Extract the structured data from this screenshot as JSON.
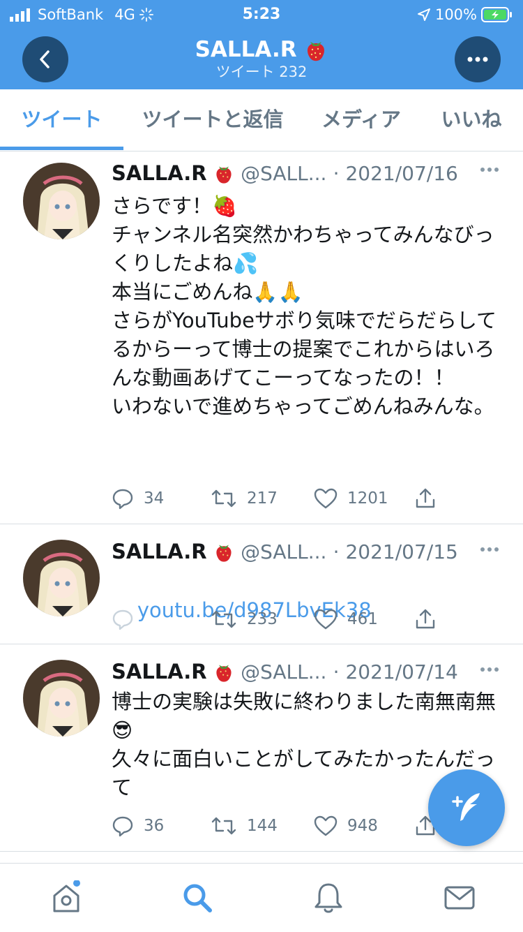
{
  "status_bar": {
    "carrier": "SoftBank",
    "network": "4G",
    "time": "5:23",
    "battery": "100%"
  },
  "header": {
    "title": "SALLA.R",
    "subtitle": "ツイート 232",
    "back_icon": "chevron-left-icon",
    "more_icon": "more-horizontal-icon"
  },
  "tabs": [
    {
      "label": "ツイート",
      "active": true
    },
    {
      "label": "ツイートと返信",
      "active": false
    },
    {
      "label": "メディア",
      "active": false
    },
    {
      "label": "いいね",
      "active": false
    }
  ],
  "tweets": [
    {
      "name": "SALLA.R",
      "handle": "@SALL...",
      "date": "· 2021/07/16",
      "text": "さらです！🍓\nチャンネル名突然かわちゃってみんなびっくりしたよね💦\n本当にごめんね🙏🙏\nさらがYouTubeサボり気味でだらだらしてるからーって博士の提案でこれからはいろんな動画あげてこーってなったの！！\nいわないで進めちゃってごめんねみんな。",
      "replies": "34",
      "retweets": "217",
      "likes": "1201"
    },
    {
      "name": "SALLA.R",
      "handle": "@SALL...",
      "date": "· 2021/07/15",
      "link": "youtu.be/d987LbvEk38",
      "replies": "",
      "retweets": "233",
      "likes": "461"
    },
    {
      "name": "SALLA.R",
      "handle": "@SALL...",
      "date": "· 2021/07/14",
      "text": "博士の実験は失敗に終わりました南無南無😎\n久々に面白いことがしてみたかったんだって",
      "replies": "36",
      "retweets": "144",
      "likes": "948"
    }
  ],
  "compose_icon": "compose-tweet-icon",
  "tabbar": [
    "home-icon",
    "search-icon",
    "notifications-icon",
    "messages-icon"
  ],
  "colors": {
    "accent": "#4a9be9",
    "header_button": "#1f4c75",
    "muted": "#657786"
  }
}
